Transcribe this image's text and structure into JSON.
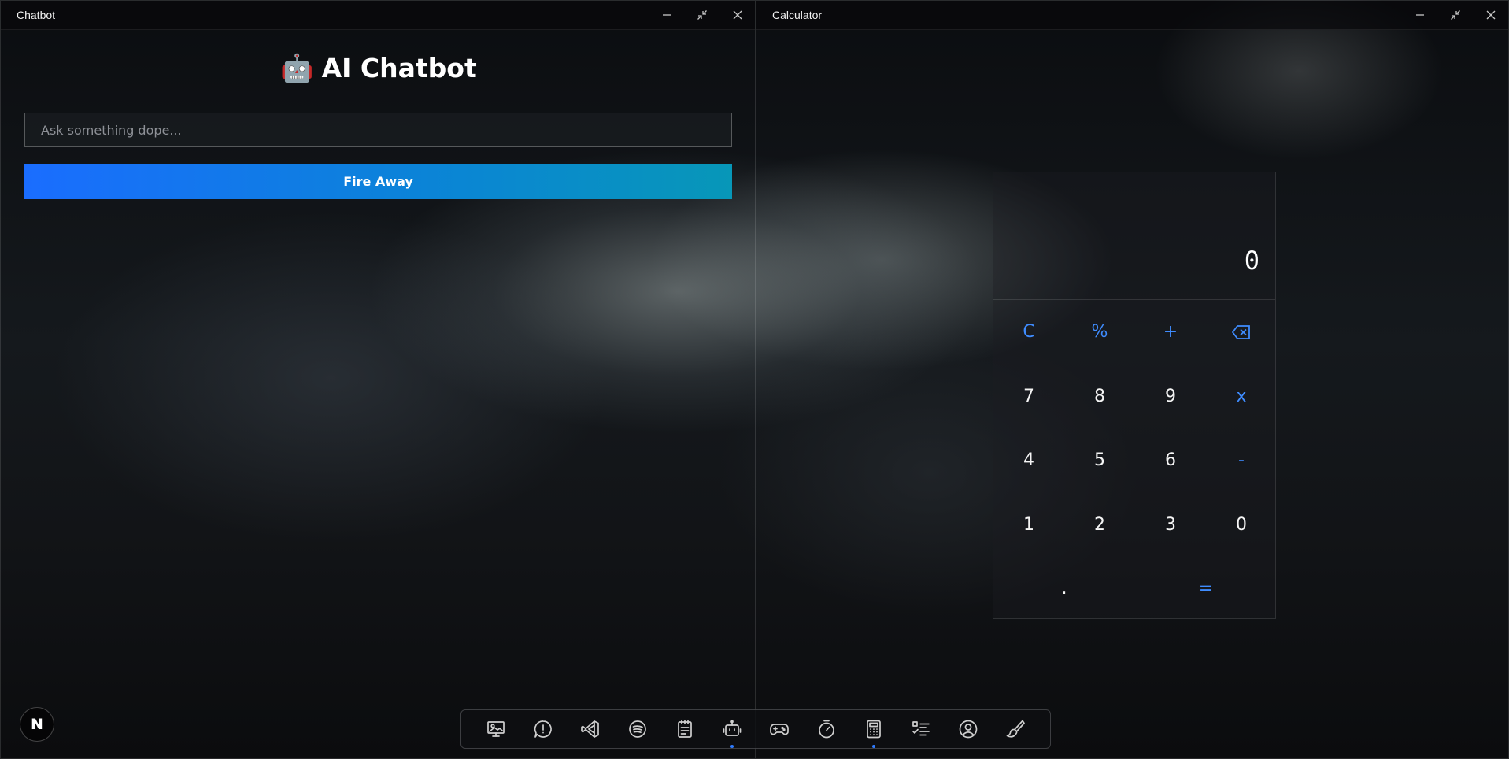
{
  "chatbot_window": {
    "title": "Chatbot",
    "heading_emoji": "🤖",
    "heading": "AI Chatbot",
    "input_placeholder": "Ask something dope...",
    "input_value": "",
    "submit_label": "Fire Away"
  },
  "calculator_window": {
    "title": "Calculator",
    "display": "0",
    "keys": [
      "C",
      "%",
      "+",
      "backspace",
      "7",
      "8",
      "9",
      "x",
      "4",
      "5",
      "6",
      "-",
      "1",
      "2",
      "3",
      "0",
      ".",
      "="
    ]
  },
  "window_controls": [
    "minimize-icon",
    "restore-icon",
    "close-icon"
  ],
  "taskbar": {
    "start_label": "N",
    "apps": [
      {
        "icon": "image-gallery-icon",
        "active": false
      },
      {
        "icon": "feedback-icon",
        "active": false
      },
      {
        "icon": "vscode-icon",
        "active": false
      },
      {
        "icon": "spotify-icon",
        "active": false
      },
      {
        "icon": "notepad-icon",
        "active": false
      },
      {
        "icon": "robot-icon",
        "active": true
      },
      {
        "icon": "gamepad-icon",
        "active": false
      },
      {
        "icon": "timer-icon",
        "active": false
      },
      {
        "icon": "calculator-icon",
        "active": true
      },
      {
        "icon": "todo-list-icon",
        "active": false
      },
      {
        "icon": "user-profile-icon",
        "active": false
      },
      {
        "icon": "paint-brush-icon",
        "active": false
      }
    ],
    "active_indicator_color": "#2f7bff"
  },
  "colors": {
    "accent": "#3f8cff",
    "button_gradient_start": "#1a6dff",
    "button_gradient_end": "#0797b8"
  }
}
